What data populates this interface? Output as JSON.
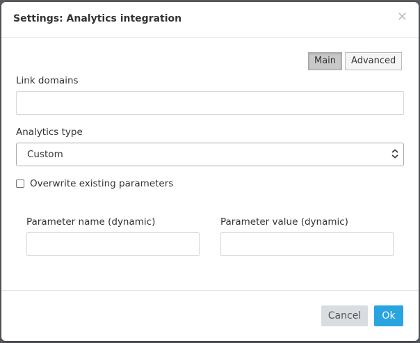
{
  "dialog": {
    "title": "Settings: Analytics integration",
    "close_glyph": "×"
  },
  "tabs": [
    {
      "label": "Main",
      "active": true
    },
    {
      "label": "Advanced",
      "active": false
    }
  ],
  "fields": {
    "link_domains": {
      "label": "Link domains",
      "value": ""
    },
    "analytics_type": {
      "label": "Analytics type",
      "selected": "Custom"
    },
    "overwrite": {
      "label": "Overwrite existing parameters",
      "checked": false
    },
    "param_name": {
      "label": "Parameter name (dynamic)",
      "value": ""
    },
    "param_value": {
      "label": "Parameter value (dynamic)",
      "value": ""
    }
  },
  "footer": {
    "cancel_label": "Cancel",
    "ok_label": "Ok"
  },
  "colors": {
    "ok_button": "#2aa4e0",
    "cancel_button": "#d9dde1",
    "active_tab": "#c9c9c9"
  },
  "icons": {
    "close": "close-icon",
    "select_arrow": "chevron-updown-icon"
  }
}
